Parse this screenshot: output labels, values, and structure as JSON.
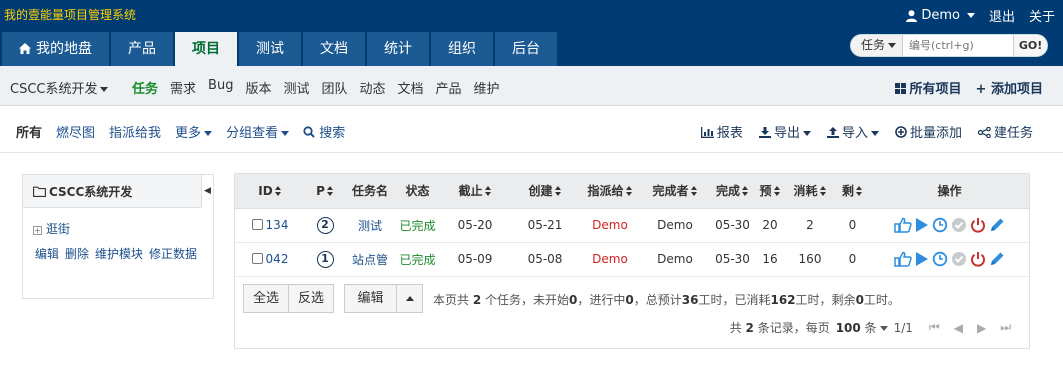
{
  "header": {
    "app_title": "我的壹能量项目管理系统",
    "user": "Demo",
    "logout": "退出",
    "about": "关于"
  },
  "mainnav": {
    "tabs": [
      {
        "label": "我的地盘"
      },
      {
        "label": "产品"
      },
      {
        "label": "项目"
      },
      {
        "label": "测试"
      },
      {
        "label": "文档"
      },
      {
        "label": "统计"
      },
      {
        "label": "组织"
      },
      {
        "label": "后台"
      }
    ],
    "active": "项目"
  },
  "search": {
    "type": "任务",
    "placeholder": "编号(ctrl+g)",
    "go": "GO!"
  },
  "subnav": {
    "project": "CSCC系统开发",
    "items": [
      "任务",
      "需求",
      "Bug",
      "版本",
      "测试",
      "团队",
      "动态",
      "文档",
      "产品",
      "维护"
    ],
    "active": "任务",
    "all_projects": "所有项目",
    "add_project": "添加项目"
  },
  "featurebar": {
    "left": [
      "所有",
      "燃尽图",
      "指派给我",
      "更多",
      "分组查看",
      "搜索"
    ],
    "right": [
      "报表",
      "导出",
      "导入",
      "批量添加",
      "建任务"
    ]
  },
  "sidebar": {
    "title": "CSCC系统开发",
    "tree_item": "逛街",
    "actions": [
      "编辑",
      "删除",
      "维护模块",
      "修正数据"
    ]
  },
  "table": {
    "columns": [
      "ID",
      "P",
      "任务名",
      "状态",
      "截止",
      "创建",
      "指派给",
      "完成者",
      "完成",
      "预",
      "消耗",
      "剩",
      "操作"
    ],
    "rows": [
      {
        "id": "134",
        "p": "2",
        "name": "测试",
        "status": "已完成",
        "deadline": "05-20",
        "created": "05-21",
        "assigned": "Demo",
        "finisher": "Demo",
        "finished": "05-30",
        "estimate": "20",
        "consumed": "2",
        "left": "0"
      },
      {
        "id": "042",
        "p": "1",
        "name": "站点管",
        "status": "已完成",
        "deadline": "05-09",
        "created": "05-08",
        "assigned": "Demo",
        "finisher": "Demo",
        "finished": "05-30",
        "estimate": "16",
        "consumed": "160",
        "left": "0"
      }
    ]
  },
  "footer": {
    "select_all": "全选",
    "invert": "反选",
    "edit": "编辑",
    "summary": {
      "p1": "本页共 ",
      "count": "2",
      "p2": " 个任务，未开始",
      "wait": "0",
      "p3": "，进行中",
      "doing": "0",
      "p4": "，总预计",
      "estimate": "36",
      "p5": "工时，已消耗",
      "consumed": "162",
      "p6": "工时，剩余",
      "left": "0",
      "p7": "工时。"
    },
    "pager": {
      "records_pre": "共 ",
      "records": "2",
      "records_post": " 条记录，每页 ",
      "per_page": "100",
      "per_page_unit": " 条",
      "page": "1/1"
    }
  },
  "colors": {
    "header_bg": "#003b73",
    "title_yellow": "#ffd200",
    "tab_bg": "#1b5a93",
    "active_green": "#1b8c2a",
    "assignee_red": "#d32222",
    "op_blue": "#2d8ee0",
    "op_red": "#c8342c"
  }
}
